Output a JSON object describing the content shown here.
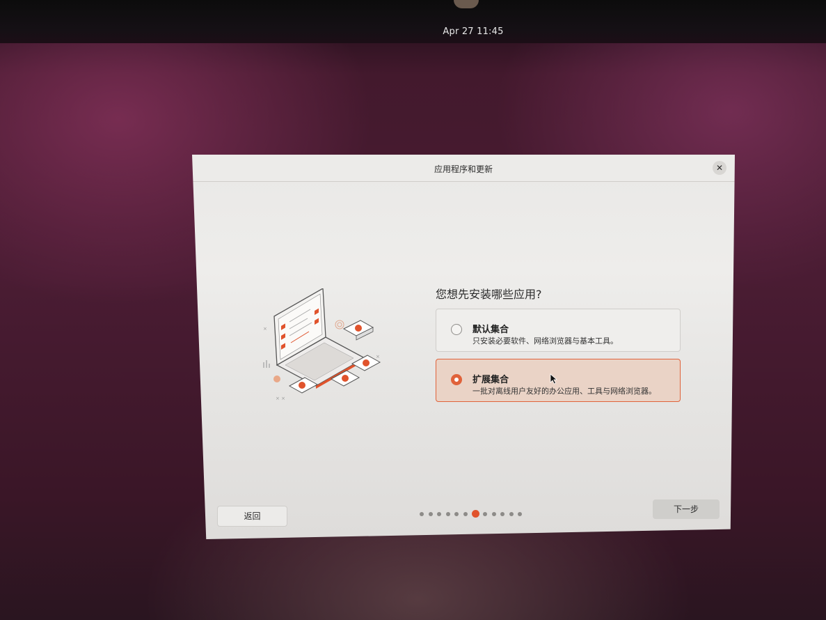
{
  "topbar": {
    "clock": "Apr 27  11:45"
  },
  "dialog": {
    "title": "应用程序和更新",
    "question": "您想先安装哪些应用?",
    "options": [
      {
        "title": "默认集合",
        "description": "只安装必要软件、网络浏览器与基本工具。",
        "selected": false
      },
      {
        "title": "扩展集合",
        "description": "一批对离线用户友好的办公应用、工具与网络浏览器。",
        "selected": true
      }
    ],
    "back_label": "返回",
    "next_label": "下一步",
    "pagination": {
      "total": 12,
      "current": 7
    }
  },
  "colors": {
    "accent": "#e0623a",
    "selected_bg": "#ead3c6",
    "dialog_bg": "#eeedeb"
  },
  "icons": {
    "close": "close-icon",
    "illustration": "laptop-apps-illustration"
  }
}
